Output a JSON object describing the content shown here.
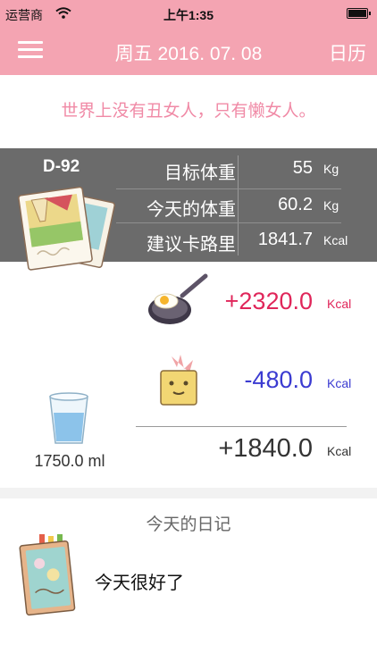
{
  "status_bar": {
    "carrier": "运营商",
    "time": "上午1:35"
  },
  "nav": {
    "title": "周五 2016. 07. 08",
    "calendar_label": "日历"
  },
  "quote": "世界上没有丑女人，只有懒女人。",
  "stats": {
    "dday": "D-92",
    "rows": [
      {
        "label": "目标体重",
        "value": "55",
        "unit": "Kg"
      },
      {
        "label": "今天的体重",
        "value": "60.2",
        "unit": "Kg"
      },
      {
        "label": "建议卡路里",
        "value": "1841.7",
        "unit": "Kcal"
      }
    ]
  },
  "calories": {
    "intake": {
      "value": "+2320.0",
      "unit": "Kcal",
      "color": "#e0265a"
    },
    "burned": {
      "value": "-480.0",
      "unit": "Kcal",
      "color": "#3b3bd1"
    },
    "total": {
      "value": "+1840.0",
      "unit": "Kcal"
    }
  },
  "water": {
    "value": "1750.0 ml"
  },
  "diary": {
    "title": "今天的日记",
    "text": "今天很好了"
  },
  "colors": {
    "accent": "#f4a4b2",
    "stats_bg": "#6b6b6b",
    "quote": "#f08aa6"
  }
}
